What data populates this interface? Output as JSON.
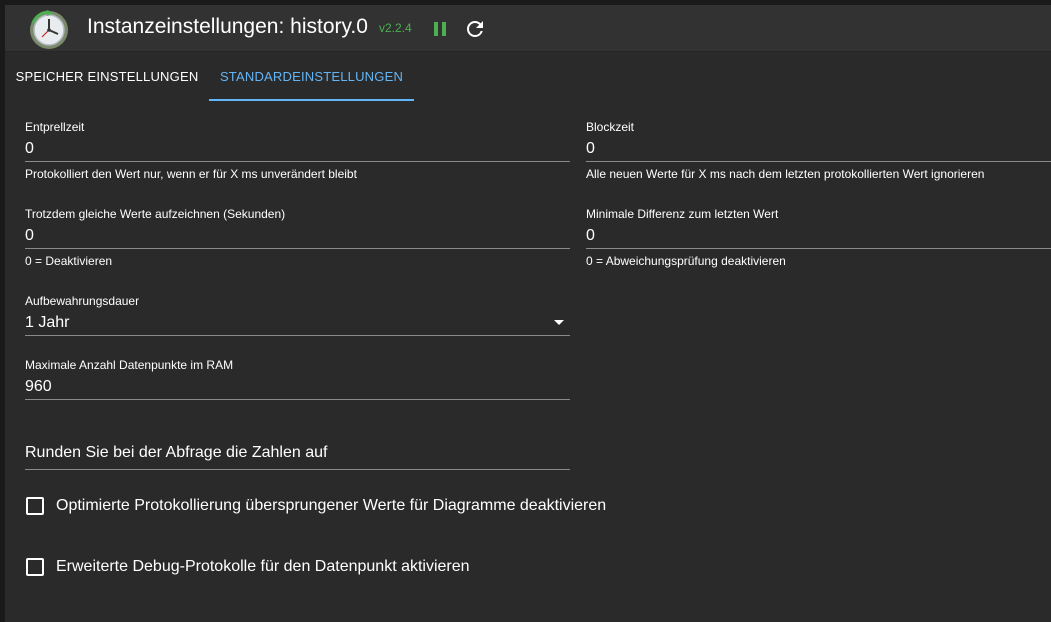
{
  "header": {
    "title": "Instanzeinstellungen: history.0",
    "version": "v2.2.4",
    "pause_icon": "pause-icon",
    "reload_icon": "reload-icon",
    "colors": {
      "version": "#4caf50",
      "pause": "#4caf50",
      "accent": "#64b5f6"
    }
  },
  "tabs": [
    {
      "label": "SPEICHER EINSTELLUNGEN",
      "active": false
    },
    {
      "label": "STANDARDEINSTELLUNGEN",
      "active": true
    }
  ],
  "fields": {
    "debounce": {
      "label": "Entprellzeit",
      "value": "0",
      "helper": "Protokolliert den Wert nur, wenn er für X ms unverändert bleibt"
    },
    "blocktime": {
      "label": "Blockzeit",
      "value": "0",
      "helper": "Alle neuen Werte für X ms nach dem letzten protokollierten Wert ignorieren"
    },
    "changes_relog": {
      "label": "Trotzdem gleiche Werte aufzeichnen (Sekunden)",
      "value": "0",
      "helper": "0 = Deaktivieren"
    },
    "changes_min_delta": {
      "label": "Minimale Differenz zum letzten Wert",
      "value": "0",
      "helper": "0 = Abweichungsprüfung deaktivieren"
    },
    "retention": {
      "label": "Aufbewahrungsdauer",
      "value": "1 Jahr"
    },
    "max_length": {
      "label": "Maximale Anzahl Datenpunkte im RAM",
      "value": "960"
    },
    "round": {
      "placeholder": "Runden Sie bei der Abfrage die Zahlen auf",
      "value": ""
    }
  },
  "checkboxes": [
    {
      "label": "Optimierte Protokollierung übersprungener Werte für Diagramme deaktivieren",
      "checked": false
    },
    {
      "label": "Erweiterte Debug-Protokolle für den Datenpunkt aktivieren",
      "checked": false
    }
  ]
}
